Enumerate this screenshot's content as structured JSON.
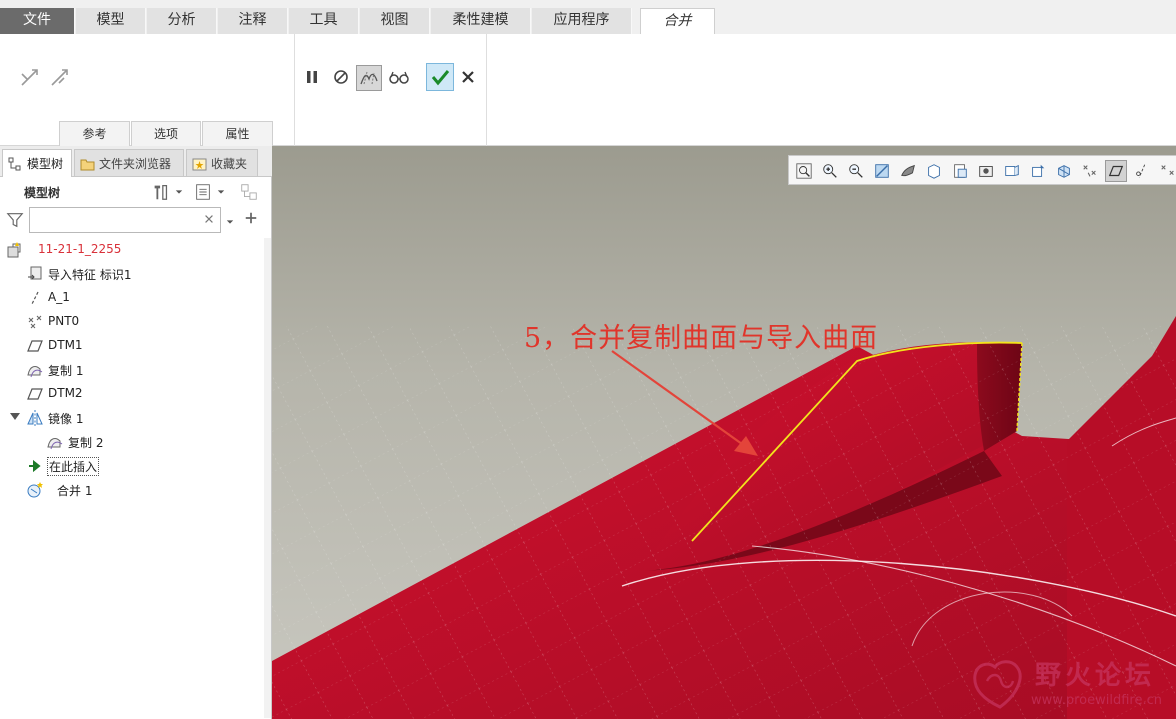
{
  "ribbon": {
    "tabs": [
      {
        "label": "文件",
        "kind": "file"
      },
      {
        "label": "模型",
        "kind": "normal"
      },
      {
        "label": "分析",
        "kind": "normal"
      },
      {
        "label": "注释",
        "kind": "normal"
      },
      {
        "label": "工具",
        "kind": "normal"
      },
      {
        "label": "视图",
        "kind": "normal"
      },
      {
        "label": "柔性建模",
        "kind": "normal"
      },
      {
        "label": "应用程序",
        "kind": "normal"
      },
      {
        "label": "合并",
        "kind": "active"
      }
    ],
    "subtabs": [
      "参考",
      "选项",
      "属性"
    ],
    "buttons": {
      "pause": "pause-icon",
      "no_preview": "no-preview-icon",
      "verify": "verify-preview-icon",
      "glasses": "glasses-icon",
      "ok": "checkmark-icon",
      "cancel": "close-icon"
    }
  },
  "left_panel": {
    "nav_tabs": [
      "模型树",
      "文件夹浏览器",
      "收藏夹"
    ],
    "tree_header": "模型树",
    "search": {
      "value": "",
      "placeholder": ""
    },
    "tree": [
      {
        "label": "11-21-1_2255",
        "icon": "part-icon",
        "style": "red"
      },
      {
        "label": "导入特征 标识1",
        "icon": "import-feature-icon"
      },
      {
        "label": "A_1",
        "icon": "axis-icon"
      },
      {
        "label": "PNT0",
        "icon": "datum-point-icon"
      },
      {
        "label": "DTM1",
        "icon": "datum-plane-icon"
      },
      {
        "label": "复制 1",
        "icon": "copy-surface-icon"
      },
      {
        "label": "DTM2",
        "icon": "datum-plane-icon"
      },
      {
        "label": "镜像 1",
        "icon": "mirror-icon"
      },
      {
        "label": "复制 2",
        "icon": "copy-surface-icon"
      },
      {
        "label": "在此插入",
        "icon": "insert-here-arrow-icon",
        "style": "boxed"
      },
      {
        "label": "合并 1",
        "icon": "merge-icon"
      }
    ]
  },
  "viewport": {
    "annotation": "5，合并复制曲面与导入曲面",
    "watermark": {
      "title": "野火论坛",
      "url": "www.proewildfire.cn"
    },
    "colors": {
      "surface": "#c8102e",
      "surface_dark": "#8f0a1e",
      "highlight": "#f2e31c",
      "arrow": "#e3443a"
    }
  }
}
